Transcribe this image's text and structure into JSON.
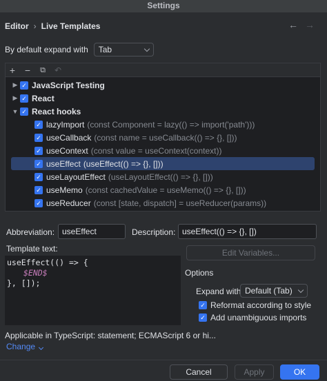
{
  "window": {
    "title": "Settings"
  },
  "breadcrumb": {
    "parent": "Editor",
    "separator": "›",
    "current": "Live Templates"
  },
  "nav": {
    "back": "←",
    "forward": "→"
  },
  "expand": {
    "label": "By default expand with",
    "value": "Tab"
  },
  "toolbar": {
    "add": "+",
    "remove": "−",
    "copy": "⧉",
    "restore": "↶"
  },
  "tree": {
    "groups": [
      {
        "name": "JavaScript Testing",
        "expanded": false
      },
      {
        "name": "React",
        "expanded": false
      },
      {
        "name": "React hooks",
        "expanded": true
      }
    ],
    "templates": [
      {
        "abbr": "lazyImport",
        "desc": "(const Component = lazy(() => import('path')))"
      },
      {
        "abbr": "useCallback",
        "desc": "(const name = useCallback(() => {}, []))"
      },
      {
        "abbr": "useContext",
        "desc": "(const value = useContext(context))"
      },
      {
        "abbr": "useEffect",
        "desc": "(useEffect(() => {}, []))"
      },
      {
        "abbr": "useLayoutEffect",
        "desc": "(useLayoutEffect(() => {}, []))"
      },
      {
        "abbr": "useMemo",
        "desc": "(const cachedValue = useMemo(() => {}, []))"
      },
      {
        "abbr": "useReducer",
        "desc": "(const [state, dispatch] = useReducer(params))"
      }
    ]
  },
  "form": {
    "abbreviation_label": "Abbreviation:",
    "abbreviation_value": "useEffect",
    "description_label": "Description:",
    "description_value": "useEffect(() => {}, [])",
    "template_label": "Template text:",
    "template_line1": "useEffect(() => {",
    "template_var": "$END$",
    "template_line3": "}, []);",
    "edit_variables": "Edit Variables..."
  },
  "options": {
    "title": "Options",
    "expand_with_label": "Expand with",
    "expand_with_value": "Default (Tab)",
    "reformat": "Reformat according to style",
    "imports": "Add unambiguous imports"
  },
  "applicable": {
    "text": "Applicable in TypeScript: statement; ECMAScript 6 or hi...",
    "change": "Change"
  },
  "footer": {
    "cancel": "Cancel",
    "apply": "Apply",
    "ok": "OK"
  },
  "colors": {
    "accent": "#3574f0",
    "selection": "#2e436e",
    "link": "#548af7",
    "background": "#2b2d30"
  }
}
